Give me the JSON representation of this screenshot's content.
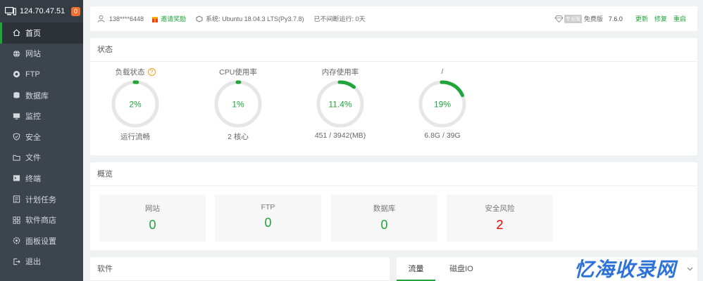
{
  "sidebar": {
    "server_ip": "124.70.47.51",
    "badge": "0",
    "items": [
      {
        "label": "首页",
        "icon": "home-icon"
      },
      {
        "label": "网站",
        "icon": "globe-icon"
      },
      {
        "label": "FTP",
        "icon": "ftp-icon"
      },
      {
        "label": "数据库",
        "icon": "database-icon"
      },
      {
        "label": "监控",
        "icon": "monitor-icon"
      },
      {
        "label": "安全",
        "icon": "shield-icon"
      },
      {
        "label": "文件",
        "icon": "folder-icon"
      },
      {
        "label": "终端",
        "icon": "terminal-icon"
      },
      {
        "label": "计划任务",
        "icon": "task-icon"
      },
      {
        "label": "软件商店",
        "icon": "store-icon"
      },
      {
        "label": "面板设置",
        "icon": "settings-icon"
      },
      {
        "label": "退出",
        "icon": "logout-icon"
      }
    ]
  },
  "topbar": {
    "user": "138****6448",
    "invite": "邀请奖励",
    "system": "系统:  Ubuntu 18.04.3 LTS(Py3.7.8)",
    "uptime": "已不间断运行: 0天",
    "pro_tag": "专业版",
    "edition": "免费版",
    "version": "7.6.0",
    "update": "更新",
    "repair": "修复",
    "restart": "重启"
  },
  "status": {
    "title": "状态",
    "gauges": [
      {
        "label": "负载状态",
        "value": "2%",
        "percent": 2,
        "sub": "运行流畅",
        "help": "?"
      },
      {
        "label": "CPU使用率",
        "value": "1%",
        "percent": 1,
        "sub": "2 核心"
      },
      {
        "label": "内存使用率",
        "value": "11.4%",
        "percent": 11.4,
        "sub": "451 / 3942(MB)"
      },
      {
        "label": "/",
        "value": "19%",
        "percent": 19,
        "sub": "6.8G / 39G"
      }
    ]
  },
  "overview": {
    "title": "概览",
    "cards": [
      {
        "label": "网站",
        "value": "0"
      },
      {
        "label": "FTP",
        "value": "0"
      },
      {
        "label": "数据库",
        "value": "0"
      },
      {
        "label": "安全风险",
        "value": "2"
      }
    ]
  },
  "software": {
    "title": "软件"
  },
  "traffic": {
    "tabs": [
      "流量",
      "磁盘IO"
    ]
  },
  "watermark": "忆海收录网",
  "colors": {
    "accent": "#20a53a",
    "sidebar": "#3c444d",
    "risk": "#ee0000",
    "badge": "#f0702f"
  }
}
